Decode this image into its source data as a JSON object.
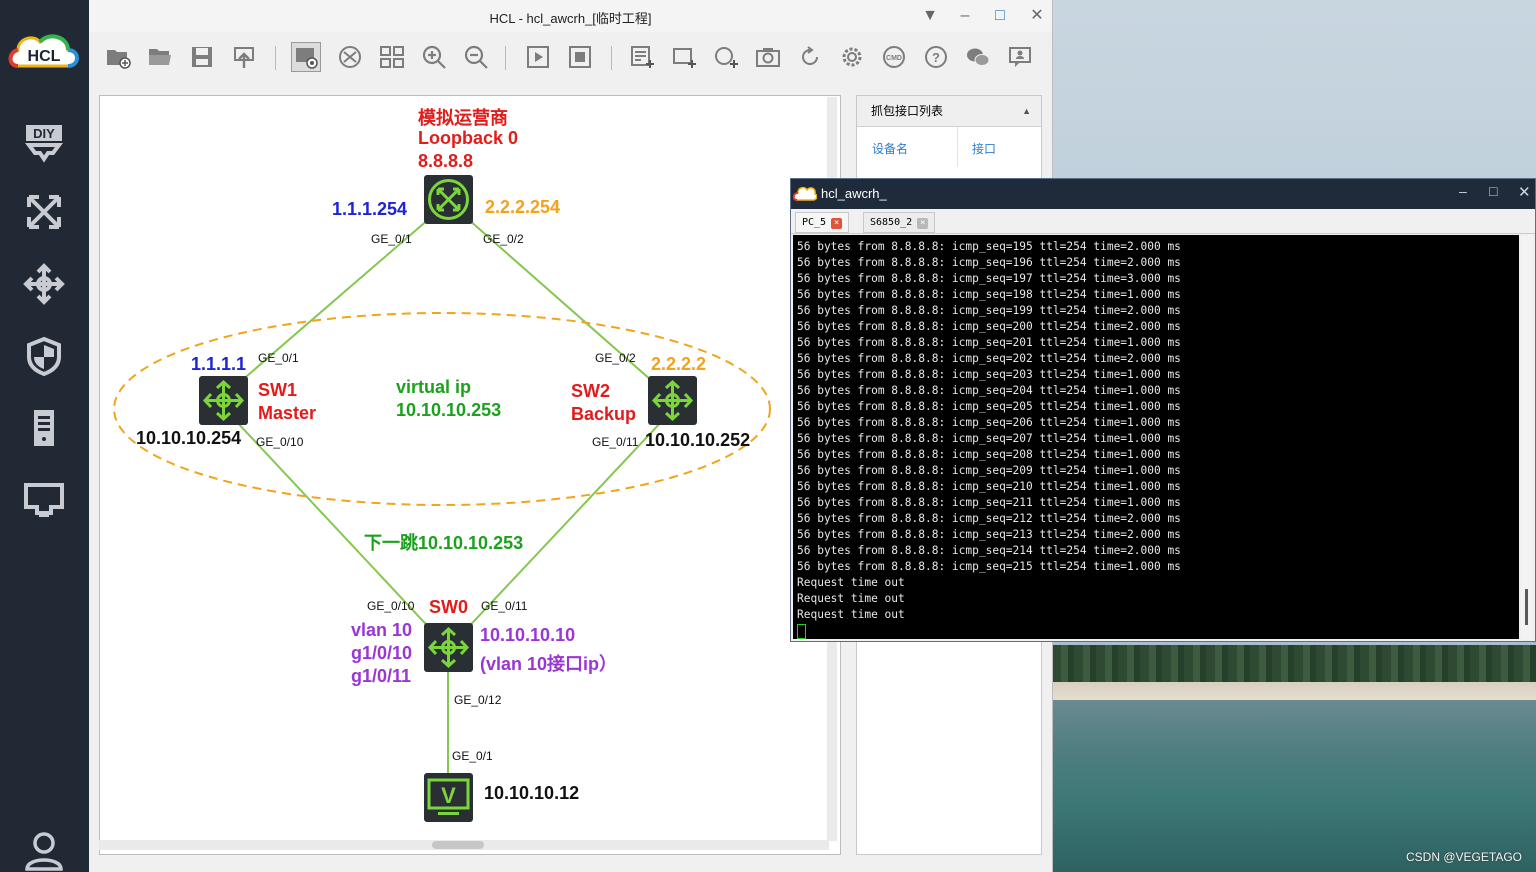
{
  "window": {
    "title": "HCL - hcl_awcrh_[临时工程]"
  },
  "sidebar": {
    "logo_text": "HCL",
    "items": [
      {
        "icon": "diy-icon"
      },
      {
        "icon": "switch-icon"
      },
      {
        "icon": "router-icon"
      },
      {
        "icon": "firewall-icon"
      },
      {
        "icon": "server-icon"
      },
      {
        "icon": "terminal-device-icon"
      },
      {
        "icon": "user-icon"
      }
    ]
  },
  "toolbar": {
    "icons": [
      "new-project-icon",
      "open-project-icon",
      "save-icon",
      "export-icon",
      "show-interface-icon",
      "topology-icon",
      "grid-icon",
      "zoom-in-icon",
      "zoom-out-icon",
      "start-icon",
      "stop-icon",
      "add-note-icon",
      "add-rectangle-icon",
      "add-ellipse-icon",
      "screenshot-icon",
      "refresh-icon",
      "settings-icon",
      "cmd-icon",
      "help-icon",
      "wechat-icon",
      "feedback-icon"
    ]
  },
  "topology": {
    "isp": {
      "title": "模拟运营商",
      "loopback": "Loopback 0",
      "loopback_ip": "8.8.8.8",
      "ip_left": "1.1.1.254",
      "ip_right": "2.2.2.254",
      "port_left": "GE_0/1",
      "port_right": "GE_0/2"
    },
    "sw1": {
      "name": "SW1",
      "role": "Master",
      "ip_top": "1.1.1.1",
      "ip_bottom": "10.10.10.254",
      "port_up": "GE_0/1",
      "port_down": "GE_0/10"
    },
    "sw2": {
      "name": "SW2",
      "role": "Backup",
      "ip_top": "2.2.2.2",
      "ip_bottom": "10.10.10.252",
      "port_up": "GE_0/2",
      "port_down": "GE_0/11"
    },
    "vrrp": {
      "line1": "virtual ip",
      "line2": "10.10.10.253"
    },
    "next_hop": "下一跳10.10.10.253",
    "sw0": {
      "name": "SW0",
      "port_left": "GE_0/10",
      "port_right": "GE_0/11",
      "port_down": "GE_0/12",
      "vlan_lines": [
        "vlan 10",
        "g1/0/10",
        "g1/0/11"
      ],
      "ip": "10.10.10.10",
      "ip_note": "(vlan 10接口ip）"
    },
    "pc": {
      "port": "GE_0/1",
      "ip": "10.10.10.12",
      "glyph": "V"
    },
    "colors": {
      "red": "#e31b1b",
      "blue": "#1d23d6",
      "orange": "#f4a21c",
      "green": "#1ca11c",
      "purple": "#9a35d6",
      "link": "#84c84f",
      "ellipse": "#f2a41b"
    }
  },
  "capture_panel": {
    "title": "抓包接口列表",
    "col_device": "设备名",
    "col_interface": "接口"
  },
  "terminal": {
    "title": "hcl_awcrh_",
    "tabs": [
      "PC_5",
      "S6850_2"
    ],
    "lines": [
      "56 bytes from 8.8.8.8: icmp_seq=195 ttl=254 time=2.000 ms",
      "56 bytes from 8.8.8.8: icmp_seq=196 ttl=254 time=2.000 ms",
      "56 bytes from 8.8.8.8: icmp_seq=197 ttl=254 time=3.000 ms",
      "56 bytes from 8.8.8.8: icmp_seq=198 ttl=254 time=1.000 ms",
      "56 bytes from 8.8.8.8: icmp_seq=199 ttl=254 time=2.000 ms",
      "56 bytes from 8.8.8.8: icmp_seq=200 ttl=254 time=2.000 ms",
      "56 bytes from 8.8.8.8: icmp_seq=201 ttl=254 time=1.000 ms",
      "56 bytes from 8.8.8.8: icmp_seq=202 ttl=254 time=2.000 ms",
      "56 bytes from 8.8.8.8: icmp_seq=203 ttl=254 time=1.000 ms",
      "56 bytes from 8.8.8.8: icmp_seq=204 ttl=254 time=1.000 ms",
      "56 bytes from 8.8.8.8: icmp_seq=205 ttl=254 time=1.000 ms",
      "56 bytes from 8.8.8.8: icmp_seq=206 ttl=254 time=1.000 ms",
      "56 bytes from 8.8.8.8: icmp_seq=207 ttl=254 time=1.000 ms",
      "56 bytes from 8.8.8.8: icmp_seq=208 ttl=254 time=1.000 ms",
      "56 bytes from 8.8.8.8: icmp_seq=209 ttl=254 time=1.000 ms",
      "56 bytes from 8.8.8.8: icmp_seq=210 ttl=254 time=1.000 ms",
      "56 bytes from 8.8.8.8: icmp_seq=211 ttl=254 time=1.000 ms",
      "56 bytes from 8.8.8.8: icmp_seq=212 ttl=254 time=2.000 ms",
      "56 bytes from 8.8.8.8: icmp_seq=213 ttl=254 time=2.000 ms",
      "56 bytes from 8.8.8.8: icmp_seq=214 ttl=254 time=2.000 ms",
      "56 bytes from 8.8.8.8: icmp_seq=215 ttl=254 time=1.000 ms",
      "Request time out",
      "Request time out",
      "Request time out"
    ]
  },
  "watermark": "CSDN @VEGETAGO"
}
